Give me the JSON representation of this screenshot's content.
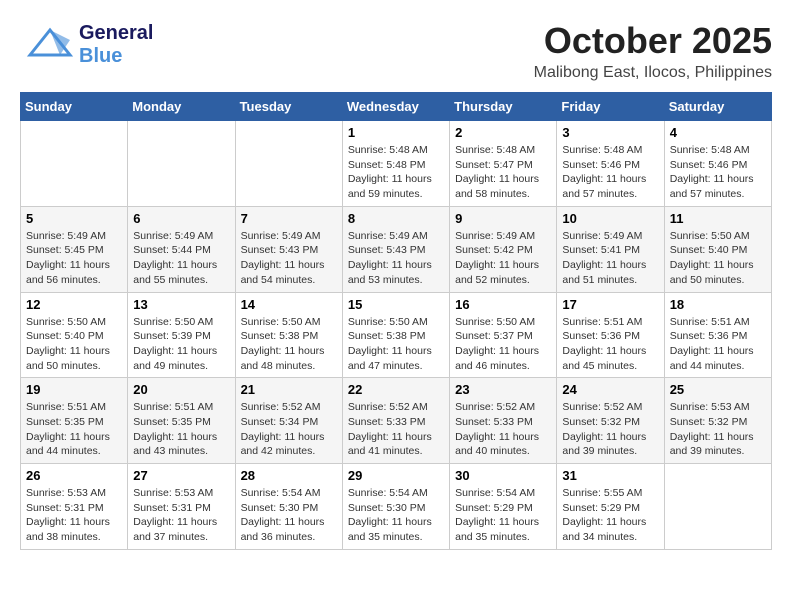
{
  "header": {
    "logo": {
      "line1": "General",
      "line2": "Blue"
    },
    "month": "October 2025",
    "location": "Malibong East, Ilocos, Philippines"
  },
  "calendar": {
    "days_of_week": [
      "Sunday",
      "Monday",
      "Tuesday",
      "Wednesday",
      "Thursday",
      "Friday",
      "Saturday"
    ],
    "weeks": [
      [
        {
          "day": "",
          "info": ""
        },
        {
          "day": "",
          "info": ""
        },
        {
          "day": "",
          "info": ""
        },
        {
          "day": "1",
          "info": "Sunrise: 5:48 AM\nSunset: 5:48 PM\nDaylight: 11 hours\nand 59 minutes."
        },
        {
          "day": "2",
          "info": "Sunrise: 5:48 AM\nSunset: 5:47 PM\nDaylight: 11 hours\nand 58 minutes."
        },
        {
          "day": "3",
          "info": "Sunrise: 5:48 AM\nSunset: 5:46 PM\nDaylight: 11 hours\nand 57 minutes."
        },
        {
          "day": "4",
          "info": "Sunrise: 5:48 AM\nSunset: 5:46 PM\nDaylight: 11 hours\nand 57 minutes."
        }
      ],
      [
        {
          "day": "5",
          "info": "Sunrise: 5:49 AM\nSunset: 5:45 PM\nDaylight: 11 hours\nand 56 minutes."
        },
        {
          "day": "6",
          "info": "Sunrise: 5:49 AM\nSunset: 5:44 PM\nDaylight: 11 hours\nand 55 minutes."
        },
        {
          "day": "7",
          "info": "Sunrise: 5:49 AM\nSunset: 5:43 PM\nDaylight: 11 hours\nand 54 minutes."
        },
        {
          "day": "8",
          "info": "Sunrise: 5:49 AM\nSunset: 5:43 PM\nDaylight: 11 hours\nand 53 minutes."
        },
        {
          "day": "9",
          "info": "Sunrise: 5:49 AM\nSunset: 5:42 PM\nDaylight: 11 hours\nand 52 minutes."
        },
        {
          "day": "10",
          "info": "Sunrise: 5:49 AM\nSunset: 5:41 PM\nDaylight: 11 hours\nand 51 minutes."
        },
        {
          "day": "11",
          "info": "Sunrise: 5:50 AM\nSunset: 5:40 PM\nDaylight: 11 hours\nand 50 minutes."
        }
      ],
      [
        {
          "day": "12",
          "info": "Sunrise: 5:50 AM\nSunset: 5:40 PM\nDaylight: 11 hours\nand 50 minutes."
        },
        {
          "day": "13",
          "info": "Sunrise: 5:50 AM\nSunset: 5:39 PM\nDaylight: 11 hours\nand 49 minutes."
        },
        {
          "day": "14",
          "info": "Sunrise: 5:50 AM\nSunset: 5:38 PM\nDaylight: 11 hours\nand 48 minutes."
        },
        {
          "day": "15",
          "info": "Sunrise: 5:50 AM\nSunset: 5:38 PM\nDaylight: 11 hours\nand 47 minutes."
        },
        {
          "day": "16",
          "info": "Sunrise: 5:50 AM\nSunset: 5:37 PM\nDaylight: 11 hours\nand 46 minutes."
        },
        {
          "day": "17",
          "info": "Sunrise: 5:51 AM\nSunset: 5:36 PM\nDaylight: 11 hours\nand 45 minutes."
        },
        {
          "day": "18",
          "info": "Sunrise: 5:51 AM\nSunset: 5:36 PM\nDaylight: 11 hours\nand 44 minutes."
        }
      ],
      [
        {
          "day": "19",
          "info": "Sunrise: 5:51 AM\nSunset: 5:35 PM\nDaylight: 11 hours\nand 44 minutes."
        },
        {
          "day": "20",
          "info": "Sunrise: 5:51 AM\nSunset: 5:35 PM\nDaylight: 11 hours\nand 43 minutes."
        },
        {
          "day": "21",
          "info": "Sunrise: 5:52 AM\nSunset: 5:34 PM\nDaylight: 11 hours\nand 42 minutes."
        },
        {
          "day": "22",
          "info": "Sunrise: 5:52 AM\nSunset: 5:33 PM\nDaylight: 11 hours\nand 41 minutes."
        },
        {
          "day": "23",
          "info": "Sunrise: 5:52 AM\nSunset: 5:33 PM\nDaylight: 11 hours\nand 40 minutes."
        },
        {
          "day": "24",
          "info": "Sunrise: 5:52 AM\nSunset: 5:32 PM\nDaylight: 11 hours\nand 39 minutes."
        },
        {
          "day": "25",
          "info": "Sunrise: 5:53 AM\nSunset: 5:32 PM\nDaylight: 11 hours\nand 39 minutes."
        }
      ],
      [
        {
          "day": "26",
          "info": "Sunrise: 5:53 AM\nSunset: 5:31 PM\nDaylight: 11 hours\nand 38 minutes."
        },
        {
          "day": "27",
          "info": "Sunrise: 5:53 AM\nSunset: 5:31 PM\nDaylight: 11 hours\nand 37 minutes."
        },
        {
          "day": "28",
          "info": "Sunrise: 5:54 AM\nSunset: 5:30 PM\nDaylight: 11 hours\nand 36 minutes."
        },
        {
          "day": "29",
          "info": "Sunrise: 5:54 AM\nSunset: 5:30 PM\nDaylight: 11 hours\nand 35 minutes."
        },
        {
          "day": "30",
          "info": "Sunrise: 5:54 AM\nSunset: 5:29 PM\nDaylight: 11 hours\nand 35 minutes."
        },
        {
          "day": "31",
          "info": "Sunrise: 5:55 AM\nSunset: 5:29 PM\nDaylight: 11 hours\nand 34 minutes."
        },
        {
          "day": "",
          "info": ""
        }
      ]
    ]
  }
}
